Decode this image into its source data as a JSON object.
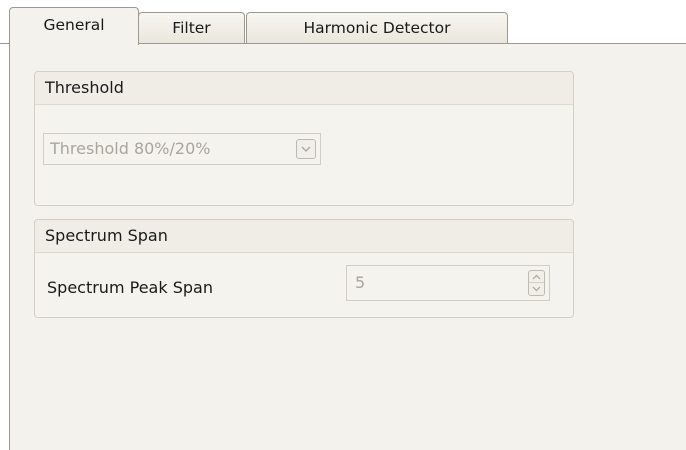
{
  "tabs": [
    {
      "label": "General",
      "active": true
    },
    {
      "label": "Filter",
      "active": false
    },
    {
      "label": "Harmonic Detector",
      "active": false
    }
  ],
  "threshold_group": {
    "title": "Threshold",
    "combo": {
      "value": "Threshold 80%/20%",
      "enabled": false,
      "dropdown_icon": "chevron-down-icon"
    }
  },
  "spectrum_group": {
    "title": "Spectrum Span",
    "peak_span": {
      "label": "Spectrum Peak Span",
      "value": "5",
      "enabled": false,
      "up_icon": "spin-up-icon",
      "down_icon": "spin-down-icon"
    }
  },
  "colors": {
    "panel_background": "#f4f2ec",
    "border": "#9c9a90",
    "disabled_text": "#a7a59c"
  }
}
